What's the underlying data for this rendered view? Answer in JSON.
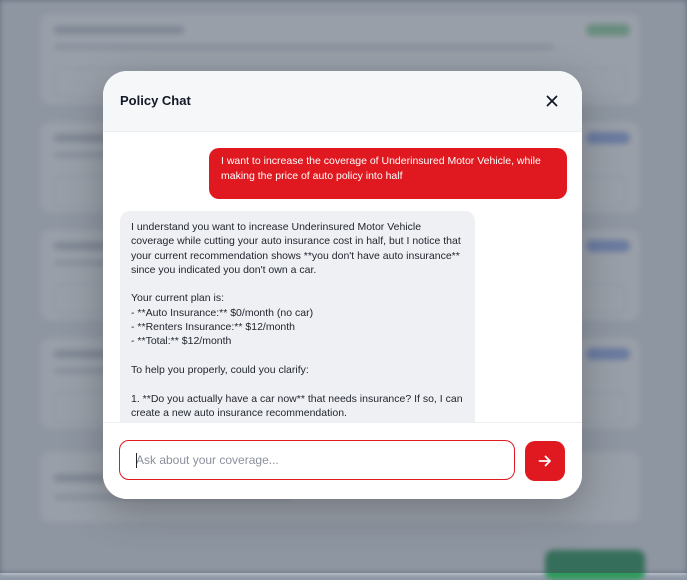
{
  "modal": {
    "title": "Policy Chat",
    "close_icon": "close-icon"
  },
  "messages": [
    {
      "role": "user",
      "text": "I want to increase the coverage of Underinsured Motor Vehicle, while making the price of auto policy into half"
    },
    {
      "role": "assistant",
      "text": "I understand you want to increase Underinsured Motor Vehicle coverage while cutting your auto insurance cost in half, but I notice that your current recommendation shows **you don't have auto insurance** since you indicated you don't own a car.\n\nYour current plan is:\n- **Auto Insurance:** $0/month (no car)\n- **Renters Insurance:** $12/month\n- **Total:** $12/month\n\nTo help you properly, could you clarify:\n\n1. **Do you actually have a car now** that needs insurance? If so, I can create a new auto insurance recommendation."
    }
  ],
  "input": {
    "placeholder": "Ask about your coverage...",
    "value": ""
  },
  "send_button": {
    "icon": "arrow-right-icon"
  },
  "colors": {
    "accent": "#e0181f",
    "assistant_bubble": "#eef0f4",
    "header_bg": "#f6f7f9"
  }
}
